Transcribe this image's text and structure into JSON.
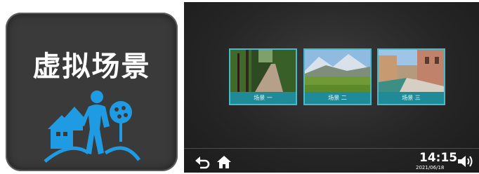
{
  "tile": {
    "title": "虚拟场景",
    "icon": "virtual-scene-icon"
  },
  "screen": {
    "scenes": [
      {
        "label": "场景 一",
        "thumbnail": "forest-path"
      },
      {
        "label": "场景 二",
        "thumbnail": "mountain-meadow"
      },
      {
        "label": "场景 三",
        "thumbnail": "canal-street"
      }
    ],
    "status": {
      "time": "14:15",
      "date": "2021/06/18"
    },
    "icons": [
      "back-icon",
      "home-icon",
      "volume-icon"
    ],
    "colors": {
      "accent": "#47b9c8",
      "caption_bg": "#1f8b98"
    }
  }
}
